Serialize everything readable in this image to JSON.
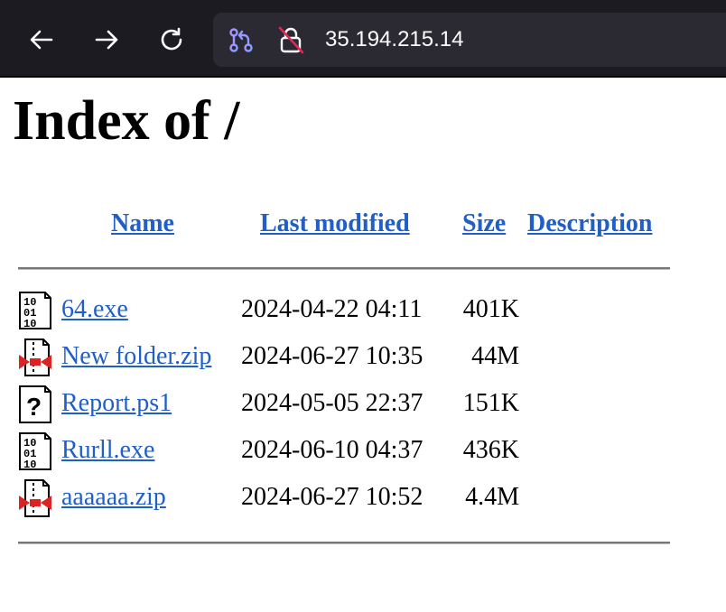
{
  "browser": {
    "url": "35.194.215.14"
  },
  "page": {
    "title": "Index of /",
    "columns": {
      "name": "Name",
      "last_modified": "Last modified",
      "size": "Size",
      "description": "Description"
    },
    "files": [
      {
        "name": "64.exe",
        "modified": "2024-04-22 04:11",
        "size": "401K",
        "description": "",
        "icon": "binary-file-icon"
      },
      {
        "name": "New folder.zip",
        "modified": "2024-06-27 10:35",
        "size": "44M",
        "description": "",
        "icon": "compressed-file-icon"
      },
      {
        "name": "Report.ps1",
        "modified": "2024-05-05 22:37",
        "size": "151K",
        "description": "",
        "icon": "unknown-file-icon"
      },
      {
        "name": "Rurll.exe",
        "modified": "2024-06-10 04:37",
        "size": "436K",
        "description": "",
        "icon": "binary-file-icon"
      },
      {
        "name": "aaaaaa.zip",
        "modified": "2024-06-27 10:52",
        "size": "4.4M",
        "description": "",
        "icon": "compressed-file-icon"
      }
    ]
  }
}
